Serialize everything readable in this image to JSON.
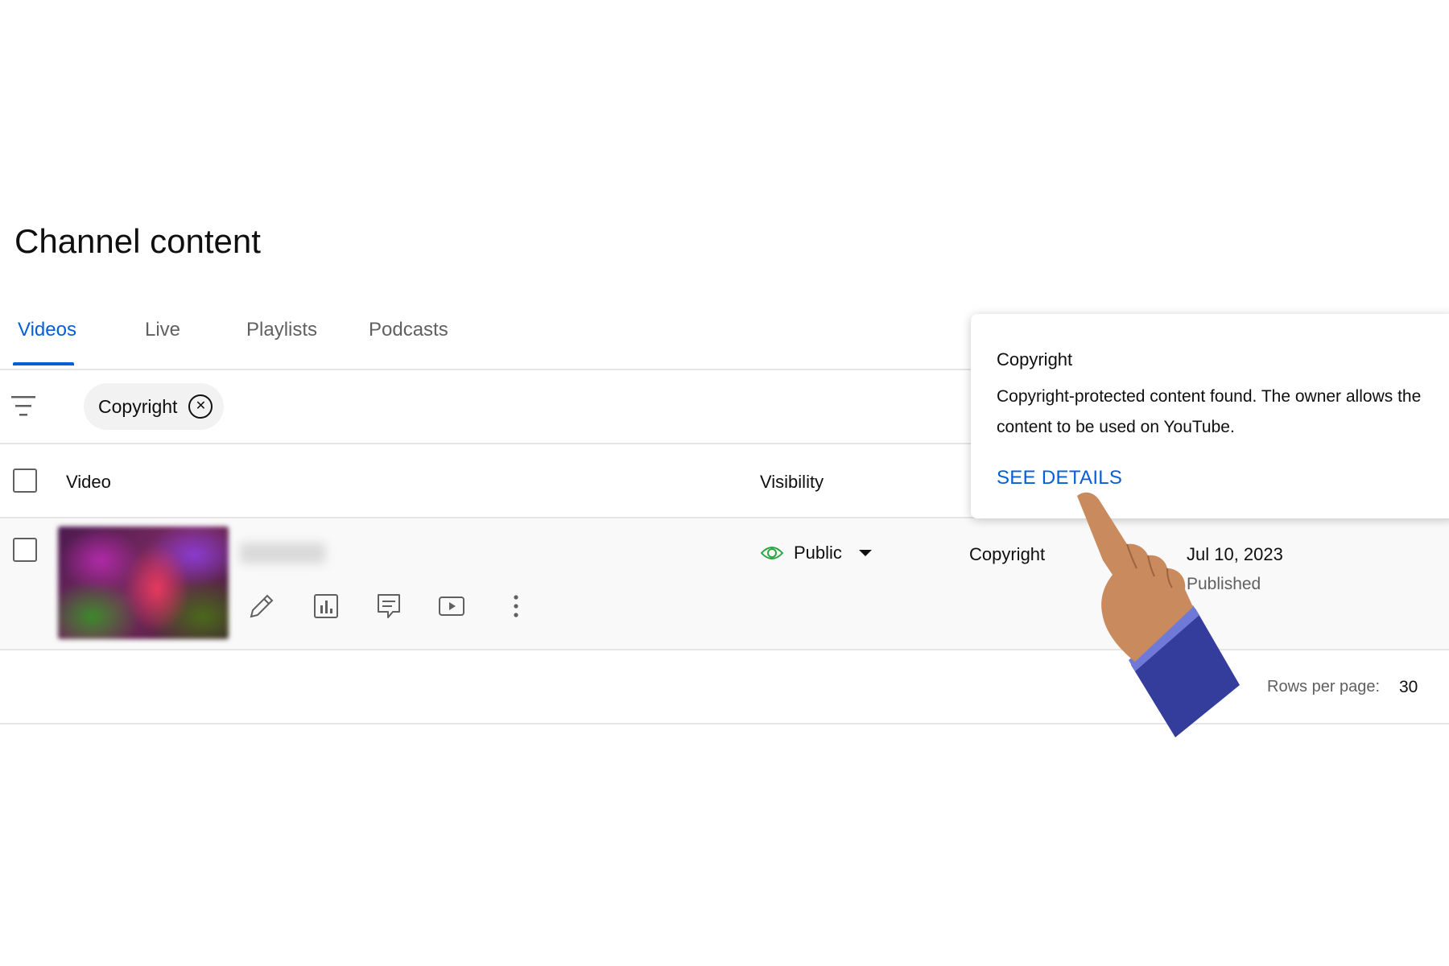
{
  "page": {
    "title": "Channel content"
  },
  "tabs": [
    {
      "label": "Videos",
      "active": true
    },
    {
      "label": "Live",
      "active": false
    },
    {
      "label": "Playlists",
      "active": false
    },
    {
      "label": "Podcasts",
      "active": false
    }
  ],
  "filter": {
    "chip_label": "Copyright"
  },
  "table": {
    "headers": {
      "video": "Video",
      "visibility": "Visibility"
    },
    "rows": [
      {
        "visibility": "Public",
        "restrictions": "Copyright",
        "date": "Jul 10, 2023",
        "status": "Published"
      }
    ]
  },
  "pagination": {
    "rows_label": "Rows per page:",
    "rows_value": "30"
  },
  "popup": {
    "title": "Copyright",
    "body": "Copyright-protected content found. The owner allows the content to be used on YouTube.",
    "link": "SEE DETAILS"
  },
  "colors": {
    "accent": "#065fd4",
    "public_icon": "#2ba640",
    "hand_sleeve": "#353d9c",
    "hand_skin": "#c98a5e"
  },
  "icons": {
    "filter": "filter-icon",
    "chip_close": "close-circle-icon",
    "edit": "pencil-icon",
    "analytics": "bar-chart-icon",
    "comments": "comments-icon",
    "youtube": "play-box-icon",
    "options": "more-vert-icon",
    "visibility": "eye-icon",
    "dropdown": "caret-down-icon"
  }
}
